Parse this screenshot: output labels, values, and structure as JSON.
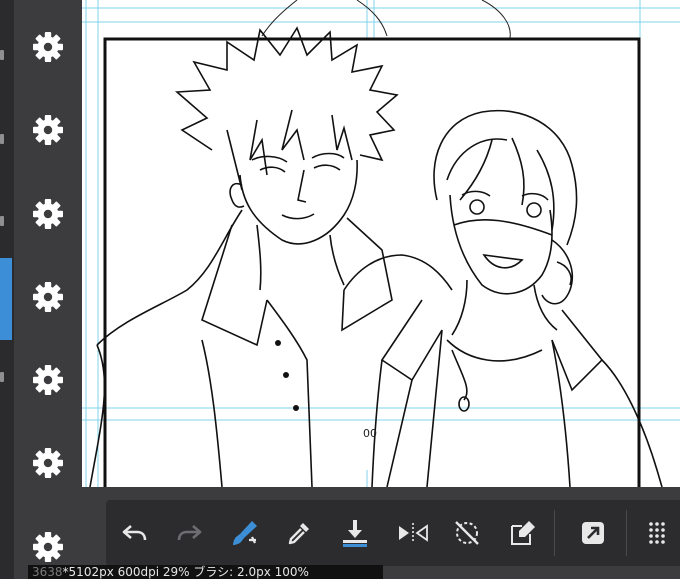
{
  "sidebar": {
    "settings_icon_count": 7
  },
  "canvas": {
    "page_number": "00"
  },
  "toolbar": {
    "buttons": [
      {
        "id": "undo",
        "icon": "undo-icon"
      },
      {
        "id": "redo",
        "icon": "redo-icon"
      },
      {
        "id": "brush",
        "icon": "brush-icon"
      },
      {
        "id": "eyedropper",
        "icon": "eyedropper-icon"
      },
      {
        "id": "save",
        "icon": "download-icon"
      },
      {
        "id": "flip",
        "icon": "flip-horizontal-icon"
      },
      {
        "id": "rotate",
        "icon": "rotate-reset-icon"
      },
      {
        "id": "transform",
        "icon": "transform-icon"
      },
      {
        "id": "share",
        "icon": "share-icon"
      },
      {
        "id": "menu",
        "icon": "grid-menu-icon"
      }
    ]
  },
  "status_bar": {
    "dim_prefix": "3638",
    "text": "*5102px 600dpi 29% ブラシ: 2.0px 100%"
  },
  "colors": {
    "sidebar_bg": "#3c3c3f",
    "toolbar_bg": "#2c2c2e",
    "accent": "#3c8fd6",
    "brush_blue": "#3c8fd6"
  }
}
